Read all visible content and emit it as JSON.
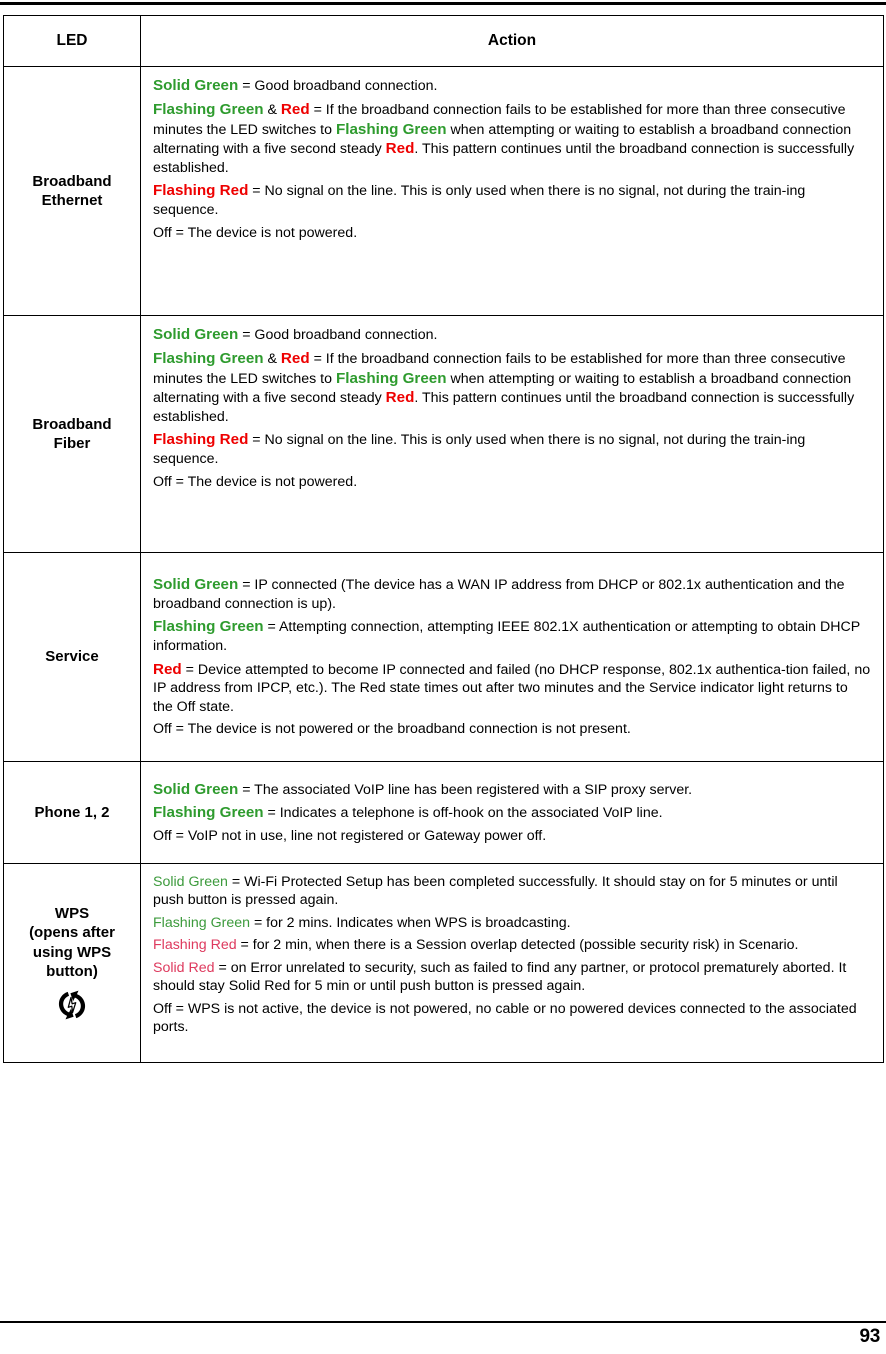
{
  "page": {
    "number": "93"
  },
  "colors": {
    "green_bold": "#2E9B2E",
    "red_bold": "#EE0000",
    "green_plain": "#3C9A3C",
    "red_plain": "#DE3A5E",
    "text": "#000000",
    "border": "#000000"
  },
  "table": {
    "headers": {
      "led": "LED",
      "action": "Action"
    },
    "rows": [
      {
        "id": "broadband-ethernet",
        "led_label": "Broadband\nEthernet",
        "led_lines": [
          "Broadband",
          "Ethernet"
        ],
        "has_icon": false,
        "label_style": "bold",
        "paragraphs": [
          {
            "runs": [
              {
                "text": "Solid Green",
                "color": "green",
                "style": "bold"
              },
              {
                "text": " = Good broadband connection.",
                "color": "black",
                "style": "plain"
              }
            ]
          },
          {
            "runs": [
              {
                "text": "Flashing Green",
                "color": "green",
                "style": "bold"
              },
              {
                "text": " & ",
                "color": "black",
                "style": "plain"
              },
              {
                "text": "Red",
                "color": "red",
                "style": "bold"
              },
              {
                "text": " = If the broadband connection fails to be established for more than three consecutive minutes the LED switches to ",
                "color": "black",
                "style": "plain"
              },
              {
                "text": "Flashing Green",
                "color": "green",
                "style": "bold"
              },
              {
                "text": " when attempting or waiting to establish a broadband connection alternating with a five second steady ",
                "color": "black",
                "style": "plain"
              },
              {
                "text": "Red",
                "color": "red",
                "style": "bold"
              },
              {
                "text": ". This pattern continues until the broadband connection is successfully established.",
                "color": "black",
                "style": "plain"
              }
            ]
          },
          {
            "runs": [
              {
                "text": "Flashing Red",
                "color": "red",
                "style": "bold"
              },
              {
                "text": " = No signal on the line. This is only used when there is no signal, not during the train-ing sequence.",
                "color": "black",
                "style": "plain"
              }
            ]
          },
          {
            "runs": [
              {
                "text": "Off = The device is not powered.",
                "color": "black",
                "style": "plain"
              }
            ]
          }
        ]
      },
      {
        "id": "broadband-fiber",
        "led_label": "Broadband\nFiber",
        "led_lines": [
          "Broadband",
          "Fiber"
        ],
        "has_icon": false,
        "label_style": "bold",
        "paragraphs": [
          {
            "runs": [
              {
                "text": "Solid Green",
                "color": "green",
                "style": "bold"
              },
              {
                "text": " = Good broadband connection.",
                "color": "black",
                "style": "plain"
              }
            ]
          },
          {
            "runs": [
              {
                "text": "Flashing Green",
                "color": "green",
                "style": "bold"
              },
              {
                "text": " & ",
                "color": "black",
                "style": "plain"
              },
              {
                "text": "Red",
                "color": "red",
                "style": "bold"
              },
              {
                "text": " = If the broadband connection fails to be established for more than three consecutive minutes the LED switches to ",
                "color": "black",
                "style": "plain"
              },
              {
                "text": "Flashing Green",
                "color": "green",
                "style": "bold"
              },
              {
                "text": " when attempting or waiting to establish a broadband connection alternating with a five second steady ",
                "color": "black",
                "style": "plain"
              },
              {
                "text": "Red",
                "color": "red",
                "style": "bold"
              },
              {
                "text": ". This pattern continues until the broadband connection is successfully established.",
                "color": "black",
                "style": "plain"
              }
            ]
          },
          {
            "runs": [
              {
                "text": "Flashing Red",
                "color": "red",
                "style": "bold"
              },
              {
                "text": " = No signal on the line. This is only used when there is no signal, not during the train-ing sequence.",
                "color": "black",
                "style": "plain"
              }
            ]
          },
          {
            "runs": [
              {
                "text": "Off = The device is not powered.",
                "color": "black",
                "style": "plain"
              }
            ]
          }
        ]
      },
      {
        "id": "service",
        "led_label": "Service",
        "led_lines": [
          "Service"
        ],
        "has_icon": false,
        "label_style": "bold",
        "paragraphs": [
          {
            "runs": [
              {
                "text": "Solid Green",
                "color": "green",
                "style": "bold"
              },
              {
                "text": " = IP connected (The device has a WAN IP address from DHCP or 802.1x authentication and the broadband connection is up).",
                "color": "black",
                "style": "plain"
              }
            ]
          },
          {
            "runs": [
              {
                "text": "Flashing Green",
                "color": "green",
                "style": "bold"
              },
              {
                "text": " = Attempting connection, attempting IEEE 802.1X authentication or attempting to obtain DHCP information.",
                "color": "black",
                "style": "plain"
              }
            ]
          },
          {
            "runs": [
              {
                "text": "Red",
                "color": "red",
                "style": "bold"
              },
              {
                "text": " = Device attempted to become IP connected and failed (no DHCP response, 802.1x authentica-tion failed, no IP address from IPCP, etc.). The Red state times out after two minutes and the Service indicator light returns to the Off state.",
                "color": "black",
                "style": "plain"
              }
            ]
          },
          {
            "runs": [
              {
                "text": "Off = The device is not powered or the broadband connection is not present.",
                "color": "black",
                "style": "plain"
              }
            ]
          }
        ]
      },
      {
        "id": "phone-1-2",
        "led_label": "Phone 1, 2",
        "led_lines": [
          "Phone 1, 2"
        ],
        "has_icon": false,
        "label_style": "bold",
        "paragraphs": [
          {
            "runs": [
              {
                "text": "Solid Green",
                "color": "green",
                "style": "bold"
              },
              {
                "text": " = The associated VoIP line has been registered with a SIP proxy server.",
                "color": "black",
                "style": "plain"
              }
            ]
          },
          {
            "runs": [
              {
                "text": "Flashing Green",
                "color": "green",
                "style": "bold"
              },
              {
                "text": " = Indicates a telephone is off-hook on the associated VoIP line.",
                "color": "black",
                "style": "plain"
              }
            ]
          },
          {
            "runs": [
              {
                "text": "Off = VoIP not in use, line not registered or Gateway power off.",
                "color": "black",
                "style": "plain"
              }
            ]
          }
        ]
      },
      {
        "id": "wps",
        "led_label": "WPS (opens after using WPS button)",
        "led_lines": [
          "WPS",
          "(opens after",
          "using WPS",
          "button)"
        ],
        "has_icon": true,
        "icon_name": "wps-icon",
        "label_style": "plain",
        "paragraphs": [
          {
            "runs": [
              {
                "text": "Solid Green",
                "color": "green",
                "style": "plain"
              },
              {
                "text": " = Wi-Fi Protected Setup has been completed successfully. It should stay on for 5 minutes or until push button is pressed again.",
                "color": "black",
                "style": "plain"
              }
            ]
          },
          {
            "runs": [
              {
                "text": "Flashing Green",
                "color": "green",
                "style": "plain"
              },
              {
                "text": " = for 2 mins. Indicates when WPS is broadcasting.",
                "color": "black",
                "style": "plain"
              }
            ]
          },
          {
            "runs": [
              {
                "text": "Flashing Red",
                "color": "red",
                "style": "plain"
              },
              {
                "text": " = for 2 min, when there is a Session overlap detected (possible security risk) in Scenario.",
                "color": "black",
                "style": "plain"
              }
            ]
          },
          {
            "runs": [
              {
                "text": "Solid Red",
                "color": "red",
                "style": "plain"
              },
              {
                "text": " = on Error unrelated to security, such as failed to find any partner, or protocol prematurely aborted. It should stay Solid Red for 5 min or until push button is pressed again.",
                "color": "black",
                "style": "plain"
              }
            ]
          },
          {
            "runs": [
              {
                "text": "Off = WPS is not active, the device is not powered, no cable or no powered devices connected to the associated ports.",
                "color": "black",
                "style": "plain"
              }
            ]
          }
        ]
      }
    ]
  }
}
